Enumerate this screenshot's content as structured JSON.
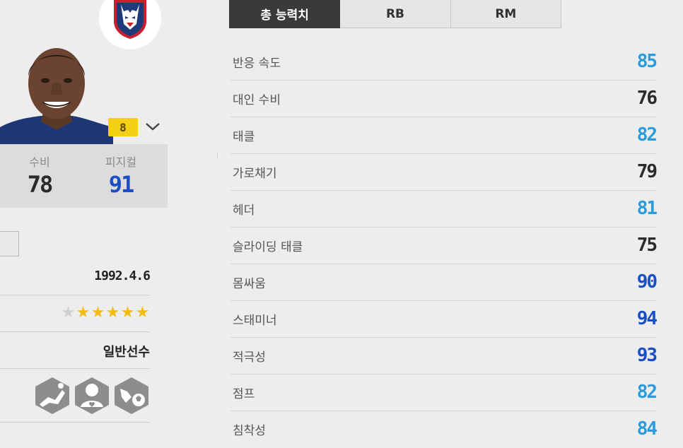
{
  "tabs": [
    {
      "label": "총 능력치",
      "active": true
    },
    {
      "label": "RB",
      "active": false
    },
    {
      "label": "RM",
      "active": false
    }
  ],
  "player": {
    "enhance_level": "8",
    "stats": [
      {
        "label": "수비",
        "value": "78"
      },
      {
        "label": "피지컬",
        "value": "91"
      }
    ],
    "birth_date": "1992.4.6",
    "weak_foot_stars": 5,
    "skill_stars_total": 6,
    "player_type": "일반선수",
    "trait_icons": [
      "sliding-tackle-trait-icon",
      "team-player-trait-icon",
      "ball-winner-trait-icon"
    ]
  },
  "attributes": [
    {
      "name": "반응 속도",
      "value": "85",
      "color": "#2d9ad9"
    },
    {
      "name": "대인 수비",
      "value": "76",
      "color": "#2a2a2a"
    },
    {
      "name": "태클",
      "value": "82",
      "color": "#2d9ad9"
    },
    {
      "name": "가로채기",
      "value": "79",
      "color": "#2a2a2a"
    },
    {
      "name": "헤더",
      "value": "81",
      "color": "#2d9ad9"
    },
    {
      "name": "슬라이딩 태클",
      "value": "75",
      "color": "#2a2a2a"
    },
    {
      "name": "몸싸움",
      "value": "90",
      "color": "#1a4fc4"
    },
    {
      "name": "스태미너",
      "value": "94",
      "color": "#1a4fc4"
    },
    {
      "name": "적극성",
      "value": "93",
      "color": "#1a4fc4"
    },
    {
      "name": "점프",
      "value": "82",
      "color": "#2d9ad9"
    },
    {
      "name": "침착성",
      "value": "84",
      "color": "#2d9ad9"
    }
  ],
  "colors": {
    "accent_gold": "#f3cf16",
    "stat_light": "#2d9ad9",
    "stat_blue": "#1a4fc4",
    "stat_dark": "#2a2a2a",
    "active_tab": "#3a3a3a"
  }
}
